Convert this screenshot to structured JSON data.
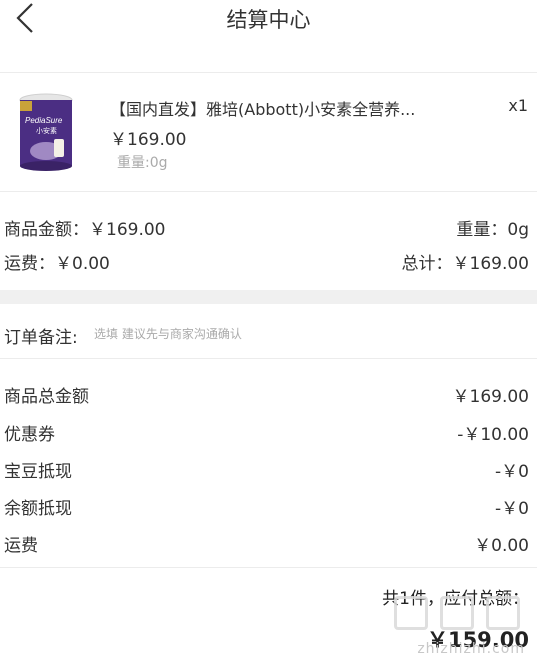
{
  "header": {
    "title": "结算中心",
    "back_icon": "chevron-left-icon"
  },
  "product": {
    "image": "product-can-image",
    "brand_colors": {
      "can": "#4b2e83",
      "lid": "#e6e6e6"
    },
    "name": "【国内直发】雅培(Abbott)小安素全营养...",
    "qty": "x1",
    "price": "￥169.00",
    "weight": "重量:0g"
  },
  "subtotal": {
    "goods_amount_label": "商品金额：",
    "goods_amount_value": "￥169.00",
    "weight_label": "重量：",
    "weight_value": "0g",
    "shipping_label": "运费：",
    "shipping_value": "￥0.00",
    "total_label": "总计：",
    "total_value": "￥169.00"
  },
  "remark": {
    "label": "订单备注:",
    "placeholder": "选填 建议先与商家沟通确认"
  },
  "summary": [
    {
      "label": "商品总金额",
      "value": "￥169.00"
    },
    {
      "label": "优惠券",
      "value": "-￥10.00"
    },
    {
      "label": "宝豆抵现",
      "value": "-￥0"
    },
    {
      "label": "余额抵现",
      "value": "-￥0"
    },
    {
      "label": "运费",
      "value": "￥0.00"
    }
  ],
  "footer": {
    "count_text": "共1件，应付总额：",
    "pay_amount": "￥159.00"
  },
  "watermark": {
    "text": "zhizhizhi.com"
  }
}
